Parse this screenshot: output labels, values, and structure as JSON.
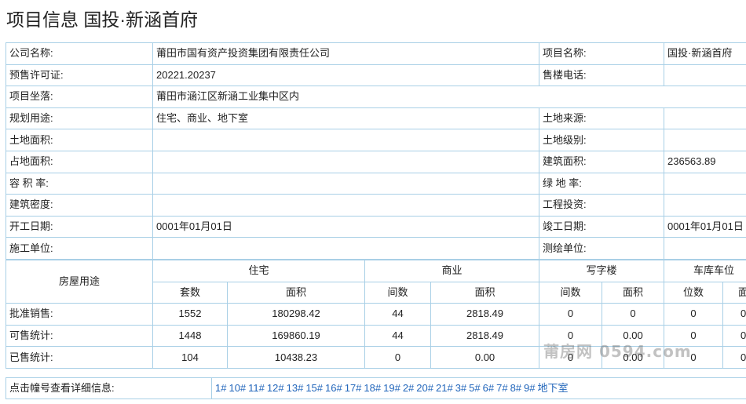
{
  "page_title": "项目信息 国投·新涵首府",
  "info": {
    "company_label": "公司名称:",
    "company": "莆田市国有资产投资集团有限责任公司",
    "project_name_label": "项目名称:",
    "project_name": "国投·新涵首府",
    "permit_label": "预售许可证:",
    "permit": "20221.20237",
    "phone_label": "售楼电话:",
    "phone": "",
    "location_label": "项目坐落:",
    "location": "莆田市涵江区新涵工业集中区内",
    "usage_label": "规划用途:",
    "usage": "住宅、商业、地下室",
    "land_source_label": "土地来源:",
    "land_source": "",
    "land_area_label": "土地面积:",
    "land_area": "",
    "land_grade_label": "土地级别:",
    "land_grade": "",
    "site_area_label": "占地面积:",
    "site_area": "",
    "build_area_label": "建筑面积:",
    "build_area": "236563.89",
    "far_label": "容 积 率:",
    "far": "",
    "green_label": "绿 地 率:",
    "green": "",
    "density_label": "建筑密度:",
    "density": "",
    "investment_label": "工程投资:",
    "investment": "",
    "start_label": "开工日期:",
    "start": "0001年01月01日",
    "finish_label": "竣工日期:",
    "finish": "0001年01月01日",
    "contractor_label": "施工单位:",
    "contractor": "",
    "surveyor_label": "测绘单位:",
    "surveyor": ""
  },
  "stats": {
    "usage_header": "房屋用途",
    "groups": [
      "住宅",
      "商业",
      "写字楼",
      "车库车位"
    ],
    "subheaders": [
      "套数",
      "面积",
      "间数",
      "面积",
      "间数",
      "面积",
      "位数",
      "面"
    ],
    "rows": [
      {
        "label": "批准销售:",
        "values": [
          "1552",
          "180298.42",
          "44",
          "2818.49",
          "0",
          "0",
          "0",
          "0"
        ]
      },
      {
        "label": "可售统计:",
        "values": [
          "1448",
          "169860.19",
          "44",
          "2818.49",
          "0",
          "0.00",
          "0",
          "0"
        ]
      },
      {
        "label": "已售统计:",
        "values": [
          "104",
          "10438.23",
          "0",
          "0.00",
          "0",
          "0.00",
          "0",
          "0"
        ]
      }
    ]
  },
  "buildings": {
    "label": "点击幢号查看详细信息:",
    "items": [
      "1#",
      "10#",
      "11#",
      "12#",
      "13#",
      "15#",
      "16#",
      "17#",
      "18#",
      "19#",
      "2#",
      "20#",
      "21#",
      "3#",
      "5#",
      "6#",
      "7#",
      "8#",
      "9#",
      "地下室"
    ]
  },
  "watermark": "莆房网 0594.com"
}
